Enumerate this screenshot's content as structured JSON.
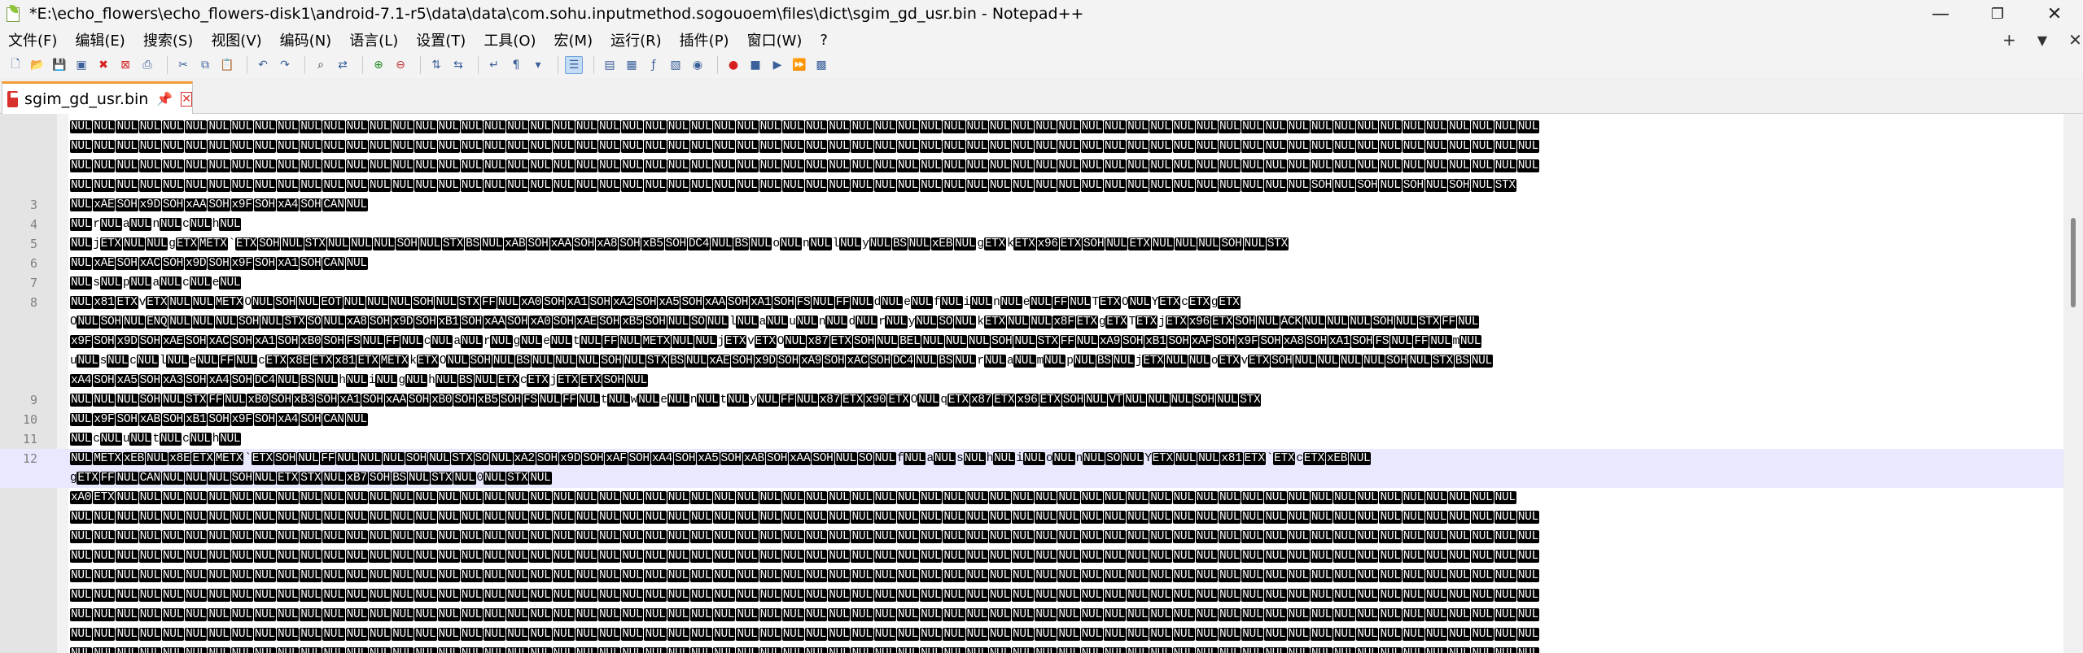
{
  "window": {
    "title": "*E:\\echo_flowers\\echo_flowers-disk1\\android-7.1-r5\\data\\data\\com.sohu.inputmethod.sogouoem\\files\\dict\\sgim_gd_usr.bin - Notepad++",
    "minimize": "—",
    "maximize": "❐",
    "close": "✕"
  },
  "menu": {
    "items": [
      "文件(F)",
      "编辑(E)",
      "搜索(S)",
      "视图(V)",
      "编码(N)",
      "语言(L)",
      "设置(T)",
      "工具(O)",
      "宏(M)",
      "运行(R)",
      "插件(P)",
      "窗口(W)",
      "?"
    ],
    "right": [
      "+",
      "▼",
      "✕"
    ]
  },
  "toolbar": {
    "icons": [
      "new-file-icon",
      "open-file-icon",
      "save-icon",
      "save-all-icon",
      "close-icon",
      "close-all-icon",
      "print-icon",
      "sep",
      "cut-icon",
      "copy-icon",
      "paste-icon",
      "sep",
      "undo-icon",
      "redo-icon",
      "sep",
      "find-icon",
      "replace-icon",
      "sep",
      "zoom-in-icon",
      "zoom-out-icon",
      "sep",
      "sync-v-icon",
      "sync-h-icon",
      "sep",
      "word-wrap-icon",
      "show-all-chars-icon",
      "dropdown-icon",
      "sep",
      "indent-guide-icon",
      "sep",
      "user-lang-icon",
      "doc-map-icon",
      "func-list-icon",
      "folder-workspace-icon",
      "monitor-icon",
      "sep",
      "record-macro-icon",
      "stop-macro-icon",
      "play-macro-icon",
      "run-macro-multiple-icon",
      "save-macro-icon"
    ]
  },
  "tab": {
    "label": "sgim_gd_usr.bin",
    "pin": "📌",
    "close": "✕"
  },
  "colors": {
    "token_bg": "#000000",
    "token_fg": "#ffffff",
    "current_line": "#e8e8ff",
    "tab_accent": "#f39c34"
  },
  "editor": {
    "lines": [
      {
        "num": "",
        "text": "NUL NUL NUL NUL NUL NUL NUL NUL NUL NUL NUL NUL NUL NUL NUL NUL NUL NUL NUL NUL NUL NUL NUL NUL NUL NUL NUL NUL NUL NUL NUL NUL NUL NUL NUL NUL NUL NUL NUL NUL NUL NUL NUL NUL NUL NUL NUL NUL NUL NUL NUL NUL NUL NUL NUL NUL NUL NUL NUL NUL NUL NUL NUL NUL"
      },
      {
        "num": "",
        "text": "NUL NUL NUL NUL NUL NUL NUL NUL NUL NUL NUL NUL NUL NUL NUL NUL NUL NUL NUL NUL NUL NUL NUL NUL NUL NUL NUL NUL NUL NUL NUL NUL NUL NUL NUL NUL NUL NUL NUL NUL NUL NUL NUL NUL NUL NUL NUL NUL NUL NUL NUL NUL NUL NUL NUL NUL NUL NUL NUL NUL NUL NUL NUL NUL"
      },
      {
        "num": "",
        "text": "NUL NUL NUL NUL NUL NUL NUL NUL NUL NUL NUL NUL NUL NUL NUL NUL NUL NUL NUL NUL NUL NUL NUL NUL NUL NUL NUL NUL NUL NUL NUL NUL NUL NUL NUL NUL NUL NUL NUL NUL NUL NUL NUL NUL NUL NUL NUL NUL NUL NUL NUL NUL NUL NUL NUL NUL NUL NUL NUL NUL NUL NUL NUL NUL"
      },
      {
        "num": "",
        "text": "NUL NUL NUL NUL NUL NUL NUL NUL NUL NUL NUL NUL NUL NUL NUL NUL NUL NUL NUL NUL NUL NUL NUL NUL NUL NUL NUL NUL NUL NUL NUL NUL NUL NUL NUL NUL NUL NUL NUL NUL NUL NUL NUL NUL NUL NUL NUL NUL NUL NUL NUL NUL NUL NUL SOH NUL SOH NUL SOH NUL SOH NUL STX"
      },
      {
        "num": "3",
        "text": "NUL xAE SOH x9D SOH xAA SOH x9F SOH xA4 SOH CAN NUL"
      },
      {
        "num": "4",
        "text": "NUL r NUL a NUL n NUL c NUL h NUL"
      },
      {
        "num": "5",
        "text": "NUL j ETX NUL NUL g ETX METX ` ETX SOH NUL STX NUL NUL NUL SOH NUL STX BS NUL xAB SOH xAA SOH xA8 SOH xB5 SOH DC4 NUL BS NUL o NUL n NUL l NUL y NUL BS NUL xEB NUL g ETX k ETX x96 ETX SOH NUL ETX NUL NUL NUL SOH NUL STX"
      },
      {
        "num": "6",
        "text": "NUL xAE SOH xAC SOH x9D SOH x9F SOH xA1 SOH CAN NUL"
      },
      {
        "num": "7",
        "text": "NUL s NUL p NUL a NUL c NUL e NUL"
      },
      {
        "num": "8",
        "text": "NUL x81 ETX v ETX NUL NUL METX O NUL SOH NUL EOT NUL NUL NUL SOH NUL STX FF NUL xA0 SOH xA1 SOH xA2 SOH xA5 SOH xAA SOH xA1 SOH FS NUL FF NUL d NUL e NUL f NUL i NUL n NUL e NUL FF NUL T ETX O NUL Y ETX c ETX g ETX"
      },
      {
        "num": "",
        "text": "O NUL SOH NUL ENQ NUL NUL NUL SOH NUL STX SO NUL xA8 SOH x9D SOH xB1 SOH xAA SOH xA0 SOH xAE SOH xB5 SOH NUL SO NUL l NUL a NUL u NUL n NUL d NUL r NUL y NUL SO NUL k ETX NUL NUL x8F ETX g ETX T ETX j ETX x96 ETX SOH NUL ACK NUL NUL NUL SOH NUL STX FF NUL"
      },
      {
        "num": "",
        "text": "x9F SOH x9D SOH xAE SOH xAC SOH xA1 SOH xB0 SOH FS NUL FF NUL c NUL a NUL r NUL g NUL e NUL t NUL FF NUL METX NUL NUL j ETX v ETX O NUL x87 ETX SOH NUL BEL NUL NUL NUL SOH NUL STX FF NUL xA9 SOH xB1 SOH xAF SOH x9F SOH xA8 SOH xA1 SOH FS NUL FF NUL m NUL"
      },
      {
        "num": "",
        "text": "u NUL s NUL c NUL l NUL e NUL FF NUL c ETX x8E ETX x81 ETX METX k ETX O NUL SOH NUL BS NUL NUL NUL SOH NUL STX BS NUL xAE SOH x9D SOH xA9 SOH xAC SOH DC4 NUL BS NUL r NUL a NUL m NUL p NUL BS NUL j ETX NUL NUL o ETX v ETX SOH NUL NUL NUL NUL SOH NUL STX BS NUL"
      },
      {
        "num": "",
        "text": "xA4 SOH xA5 SOH xA3 SOH xA4 SOH DC4 NUL BS NUL h NUL i NUL g NUL h NUL BS NUL ETX c ETX j ETX ETX SOH NUL"
      },
      {
        "num": "9",
        "text": "NUL NUL NUL SOH NUL STX FF NUL xB0 SOH xB3 SOH xA1 SOH xAA SOH xB0 SOH xB5 SOH FS NUL FF NUL t NUL w NUL e NUL n NUL t NUL y NUL FF NUL x87 ETX x90 ETX O NUL q ETX x87 ETX x96 ETX SOH NUL VT NUL NUL NUL SOH NUL STX"
      },
      {
        "num": "10",
        "text": "NUL x9F SOH xAB SOH xB1 SOH x9F SOH xA4 SOH CAN NUL"
      },
      {
        "num": "11",
        "text": "NUL c NUL u NUL t NUL c NUL h NUL"
      },
      {
        "num": "12",
        "text": "NUL METX xEB NUL x8E ETX METX ` ETX SOH NUL FF NUL NUL NUL SOH NUL STX SO NUL xA2 SOH x9D SOH xAF SOH xA4 SOH xA5 SOH xAB SOH xAA SOH NUL SO NUL f NUL a NUL s NUL h NUL i NUL o NUL n NUL SO NUL Y ETX NUL NUL x81 ETX ` ETX c ETX xEB NUL",
        "current": true
      },
      {
        "num": "",
        "text": "g ETX FF NUL CAN NUL NUL NUL SOH NUL ETX STX NUL xB7 SOH BS NUL STX NUL 0 NUL STX NUL",
        "current": true
      },
      {
        "num": "",
        "text": "xA0 ETX NUL NUL NUL NUL NUL NUL NUL NUL NUL NUL NUL NUL NUL NUL NUL NUL NUL NUL NUL NUL NUL NUL NUL NUL NUL NUL NUL NUL NUL NUL NUL NUL NUL NUL NUL NUL NUL NUL NUL NUL NUL NUL NUL NUL NUL NUL NUL NUL NUL NUL NUL NUL NUL NUL NUL NUL NUL NUL NUL NUL NUL"
      },
      {
        "num": "",
        "text": "NUL NUL NUL NUL NUL NUL NUL NUL NUL NUL NUL NUL NUL NUL NUL NUL NUL NUL NUL NUL NUL NUL NUL NUL NUL NUL NUL NUL NUL NUL NUL NUL NUL NUL NUL NUL NUL NUL NUL NUL NUL NUL NUL NUL NUL NUL NUL NUL NUL NUL NUL NUL NUL NUL NUL NUL NUL NUL NUL NUL NUL NUL NUL NUL"
      },
      {
        "num": "",
        "text": "NUL NUL NUL NUL NUL NUL NUL NUL NUL NUL NUL NUL NUL NUL NUL NUL NUL NUL NUL NUL NUL NUL NUL NUL NUL NUL NUL NUL NUL NUL NUL NUL NUL NUL NUL NUL NUL NUL NUL NUL NUL NUL NUL NUL NUL NUL NUL NUL NUL NUL NUL NUL NUL NUL NUL NUL NUL NUL NUL NUL NUL NUL NUL NUL"
      },
      {
        "num": "",
        "text": "NUL NUL NUL NUL NUL NUL NUL NUL NUL NUL NUL NUL NUL NUL NUL NUL NUL NUL NUL NUL NUL NUL NUL NUL NUL NUL NUL NUL NUL NUL NUL NUL NUL NUL NUL NUL NUL NUL NUL NUL NUL NUL NUL NUL NUL NUL NUL NUL NUL NUL NUL NUL NUL NUL NUL NUL NUL NUL NUL NUL NUL NUL NUL NUL"
      },
      {
        "num": "",
        "text": "NUL NUL NUL NUL NUL NUL NUL NUL NUL NUL NUL NUL NUL NUL NUL NUL NUL NUL NUL NUL NUL NUL NUL NUL NUL NUL NUL NUL NUL NUL NUL NUL NUL NUL NUL NUL NUL NUL NUL NUL NUL NUL NUL NUL NUL NUL NUL NUL NUL NUL NUL NUL NUL NUL NUL NUL NUL NUL NUL NUL NUL NUL NUL NUL"
      },
      {
        "num": "",
        "text": "NUL NUL NUL NUL NUL NUL NUL NUL NUL NUL NUL NUL NUL NUL NUL NUL NUL NUL NUL NUL NUL NUL NUL NUL NUL NUL NUL NUL NUL NUL NUL NUL NUL NUL NUL NUL NUL NUL NUL NUL NUL NUL NUL NUL NUL NUL NUL NUL NUL NUL NUL NUL NUL NUL NUL NUL NUL NUL NUL NUL NUL NUL NUL NUL"
      },
      {
        "num": "",
        "text": "NUL NUL NUL NUL NUL NUL NUL NUL NUL NUL NUL NUL NUL NUL NUL NUL NUL NUL NUL NUL NUL NUL NUL NUL NUL NUL NUL NUL NUL NUL NUL NUL NUL NUL NUL NUL NUL NUL NUL NUL NUL NUL NUL NUL NUL NUL NUL NUL NUL NUL NUL NUL NUL NUL NUL NUL NUL NUL NUL NUL NUL NUL NUL NUL"
      },
      {
        "num": "",
        "text": "NUL NUL NUL NUL NUL NUL NUL NUL NUL NUL NUL NUL NUL NUL NUL NUL NUL NUL NUL NUL NUL NUL NUL NUL NUL NUL NUL NUL NUL NUL NUL NUL NUL NUL NUL NUL NUL NUL NUL NUL NUL NUL NUL NUL NUL NUL NUL NUL NUL NUL NUL NUL NUL NUL NUL NUL NUL NUL NUL NUL NUL NUL NUL NUL"
      },
      {
        "num": "",
        "text": "NUL NUL NUL NUL NUL NUL NUL NUL NUL NUL NUL NUL NUL NUL NUL NUL NUL NUL NUL NUL NUL NUL NUL NUL NUL NUL NUL NUL NUL NUL NUL NUL NUL NUL NUL NUL NUL NUL NUL NUL NUL NUL NUL NUL NUL NUL NUL NUL NUL NUL NUL NUL NUL NUL NUL NUL NUL NUL NUL NUL NUL NUL NUL NUL"
      }
    ]
  }
}
